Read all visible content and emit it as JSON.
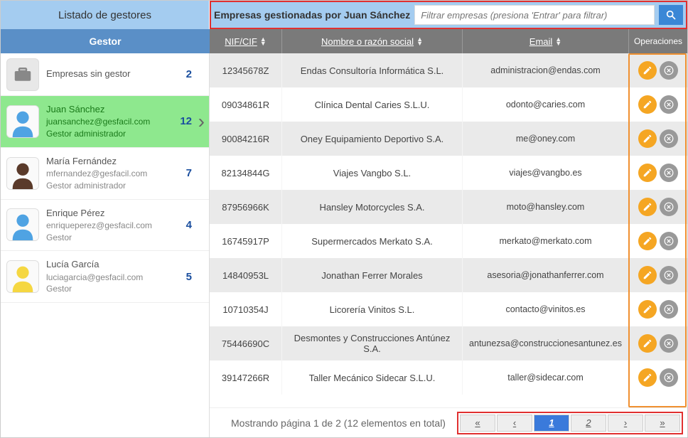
{
  "header": {
    "left_title": "Listado de gestores",
    "right_title": "Empresas gestionadas por Juan Sánchez",
    "search_placeholder": "Filtrar empresas (presiona 'Entrar' para filtrar)"
  },
  "subheader": {
    "gestor": "Gestor",
    "nif": "NIF/CIF",
    "nombre": "Nombre o razón social",
    "email": "Email",
    "ops": "Operaciones"
  },
  "gestores": [
    {
      "name": "Empresas sin gestor",
      "email": "",
      "role": "",
      "count": "2",
      "type": "nogestor",
      "avatar_color": "#888"
    },
    {
      "name": "Juan Sánchez",
      "email": "juansanchez@gesfacil.com",
      "role": "Gestor administrador",
      "count": "12",
      "type": "selected",
      "avatar_color": "#4fa3e3"
    },
    {
      "name": "María Fernández",
      "email": "mfernandez@gesfacil.com",
      "role": "Gestor administrador",
      "count": "7",
      "type": "",
      "avatar_color": "#5a3a2a"
    },
    {
      "name": "Enrique Pérez",
      "email": "enriqueperez@gesfacil.com",
      "role": "Gestor",
      "count": "4",
      "type": "",
      "avatar_color": "#4fa3e3"
    },
    {
      "name": "Lucía García",
      "email": "luciagarcia@gesfacil.com",
      "role": "Gestor",
      "count": "5",
      "type": "",
      "avatar_color": "#f5d742"
    }
  ],
  "empresas": [
    {
      "nif": "12345678Z",
      "nombre": "Endas Consultoría Informática S.L.",
      "email": "administracion@endas.com"
    },
    {
      "nif": "09034861R",
      "nombre": "Clínica Dental Caries S.L.U.",
      "email": "odonto@caries.com"
    },
    {
      "nif": "90084216R",
      "nombre": "Oney Equipamiento Deportivo S.A.",
      "email": "me@oney.com"
    },
    {
      "nif": "82134844G",
      "nombre": "Viajes Vangbo S.L.",
      "email": "viajes@vangbo.es"
    },
    {
      "nif": "87956966K",
      "nombre": "Hansley Motorcycles S.A.",
      "email": "moto@hansley.com"
    },
    {
      "nif": "16745917P",
      "nombre": "Supermercados Merkato S.A.",
      "email": "merkato@merkato.com"
    },
    {
      "nif": "14840953L",
      "nombre": "Jonathan Ferrer Morales",
      "email": "asesoria@jonathanferrer.com"
    },
    {
      "nif": "10710354J",
      "nombre": "Licorería Vinitos S.L.",
      "email": "contacto@vinitos.es"
    },
    {
      "nif": "75446690C",
      "nombre": "Desmontes y Construcciones Antúnez S.A.",
      "email": "antunezsa@construccionesantunez.es"
    },
    {
      "nif": "39147266R",
      "nombre": "Taller Mecánico Sidecar S.L.U.",
      "email": "taller@sidecar.com"
    }
  ],
  "footer": {
    "status": "Mostrando página 1 de 2 (12 elementos en total)",
    "pager": {
      "first": "«",
      "prev": "‹",
      "p1": "1",
      "p2": "2",
      "next": "›",
      "last": "»"
    }
  }
}
